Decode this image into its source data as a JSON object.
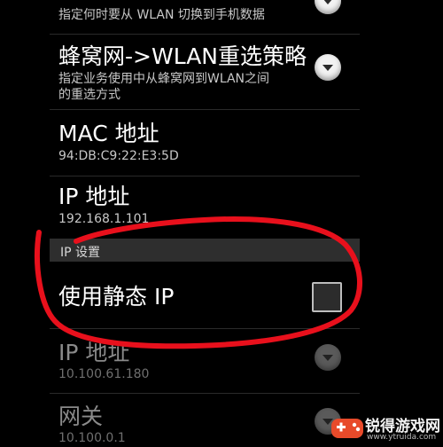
{
  "settings": {
    "rows": [
      {
        "title": "",
        "subtitle": "指定何时要从 WLAN 切换到手机数据"
      },
      {
        "title": "蜂窝网->WLAN重选策略",
        "subtitle": "指定业务使用中从蜂窝网到WLAN之间\n的重选方式"
      },
      {
        "title": "MAC 地址",
        "subtitle": "94:DB:C9:22:E3:5D"
      },
      {
        "title": "IP 地址",
        "subtitle": "192.168.1.101"
      }
    ],
    "ip_section": {
      "header": "IP 设置",
      "static_ip_label": "使用静态 IP",
      "static_ip_checked": false
    },
    "static_rows": [
      {
        "title": "IP 地址",
        "subtitle": "10.100.61.180"
      },
      {
        "title": "网关",
        "subtitle": "10.100.0.1"
      }
    ]
  },
  "icons": {
    "dropdown": "chevron-down-icon",
    "logo": "game-controller-icon"
  },
  "watermark": {
    "name": "锐得游戏网",
    "url": "www.ytruida.com"
  },
  "colors": {
    "background": "#000000",
    "annotation": "#e8101c",
    "section_header_bg": "#2e2e2e"
  }
}
